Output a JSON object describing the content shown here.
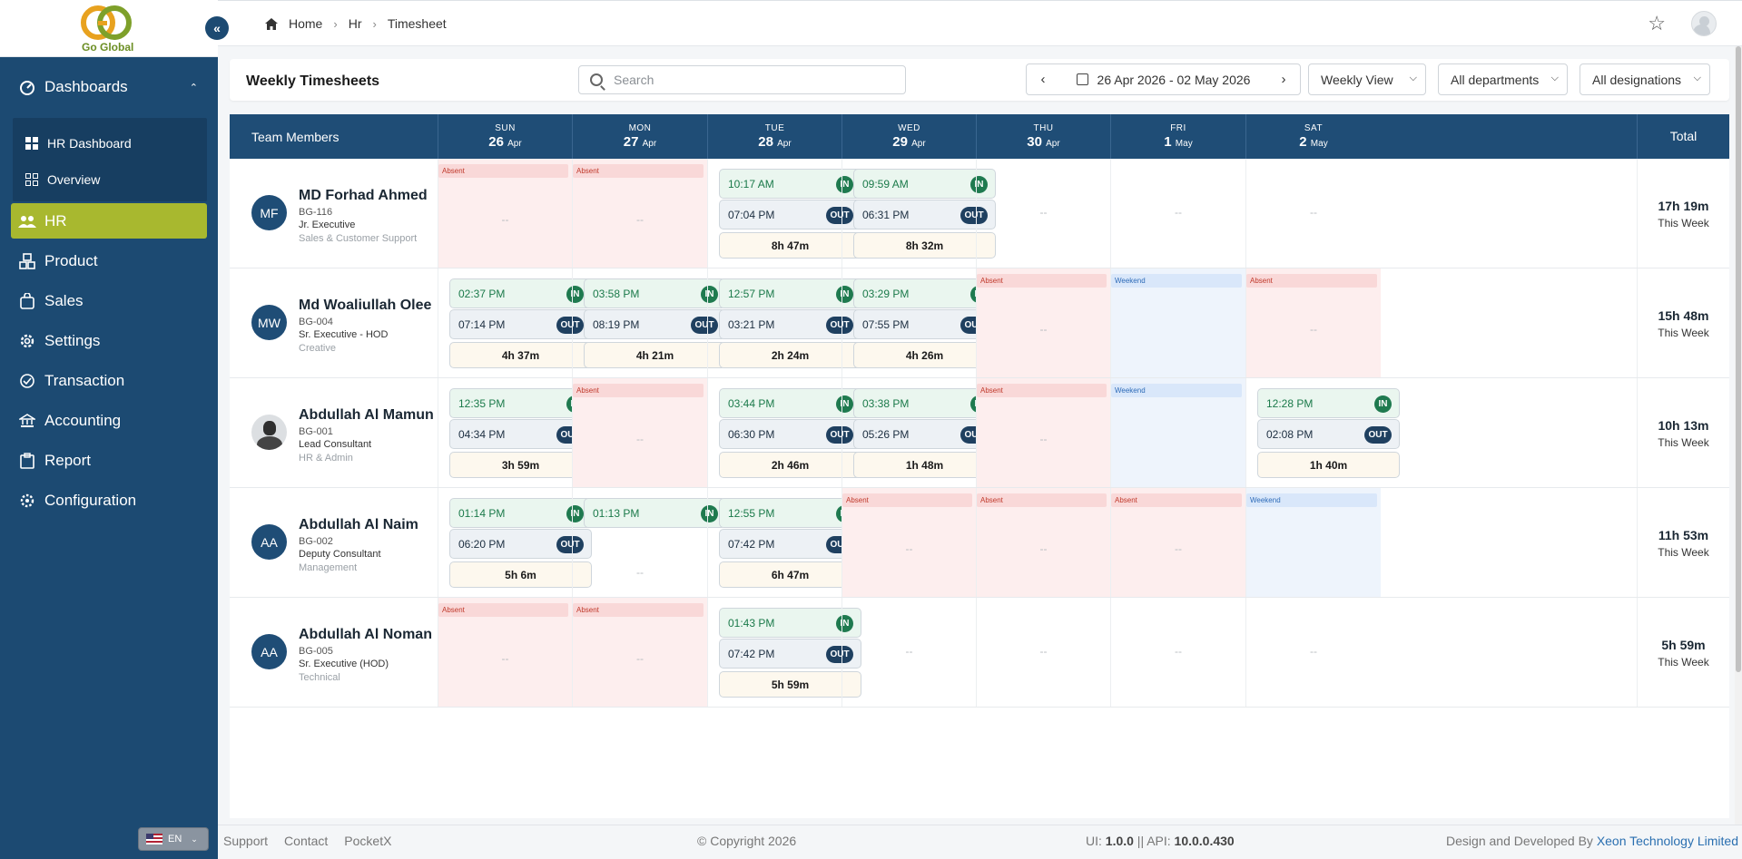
{
  "brand": {
    "name": "Go Global"
  },
  "sidebar": {
    "items": [
      {
        "label": "Dashboards",
        "icon": "dashboard-icon",
        "expanded": true
      },
      {
        "label": "HR",
        "icon": "users-icon",
        "active": true
      },
      {
        "label": "Product",
        "icon": "product-icon"
      },
      {
        "label": "Sales",
        "icon": "sales-icon"
      },
      {
        "label": "Settings",
        "icon": "gear-icon"
      },
      {
        "label": "Transaction",
        "icon": "transaction-icon"
      },
      {
        "label": "Accounting",
        "icon": "accounting-icon"
      },
      {
        "label": "Report",
        "icon": "report-icon"
      },
      {
        "label": "Configuration",
        "icon": "configuration-icon"
      }
    ],
    "submenu": [
      {
        "label": "HR Dashboard",
        "icon": "grid-icon"
      },
      {
        "label": "Overview",
        "icon": "overview-icon"
      }
    ],
    "language": "EN"
  },
  "breadcrumb": [
    "Home",
    "Hr",
    "Timesheet"
  ],
  "toolbar": {
    "title": "Weekly Timesheets",
    "search_placeholder": "Search",
    "date_range": "26 Apr 2026 - 02 May 2026",
    "view": "Weekly View",
    "department": "All departments",
    "designation": "All designations"
  },
  "table": {
    "member_header": "Team Members",
    "total_header": "Total",
    "days": [
      {
        "name": "SUN",
        "day": "26",
        "month": "Apr"
      },
      {
        "name": "MON",
        "day": "27",
        "month": "Apr"
      },
      {
        "name": "TUE",
        "day": "28",
        "month": "Apr"
      },
      {
        "name": "WED",
        "day": "29",
        "month": "Apr"
      },
      {
        "name": "THU",
        "day": "30",
        "month": "Apr"
      },
      {
        "name": "FRI",
        "day": "1",
        "month": "May"
      },
      {
        "name": "SAT",
        "day": "2",
        "month": "May"
      }
    ],
    "absent_label": "Absent",
    "weekend_label": "Weekend",
    "empty_label": "--",
    "in_label": "IN",
    "out_label": "OUT",
    "week_label": "This Week",
    "rows": [
      {
        "initials": "MF",
        "photo": false,
        "name": "MD Forhad Ahmed",
        "id": "BG-116",
        "role": "Jr. Executive",
        "dept": "Sales & Customer Support",
        "total": "17h 19m",
        "cells": [
          {
            "status": "absent"
          },
          {
            "status": "absent"
          },
          {
            "status": "present",
            "in": "10:17 AM",
            "out": "07:04 PM",
            "duration": "8h 47m"
          },
          {
            "status": "present",
            "in": "09:59 AM",
            "out": "06:31 PM",
            "duration": "8h 32m"
          },
          {
            "status": "empty"
          },
          {
            "status": "empty"
          },
          {
            "status": "empty"
          }
        ]
      },
      {
        "initials": "MW",
        "photo": false,
        "name": "Md Woaliullah Olee",
        "id": "BG-004",
        "role": "Sr. Executive - HOD",
        "dept": "Creative",
        "total": "15h 48m",
        "cells": [
          {
            "status": "present",
            "in": "02:37 PM",
            "out": "07:14 PM",
            "duration": "4h 37m"
          },
          {
            "status": "present",
            "in": "03:58 PM",
            "out": "08:19 PM",
            "duration": "4h 21m"
          },
          {
            "status": "present",
            "in": "12:57 PM",
            "out": "03:21 PM",
            "duration": "2h 24m"
          },
          {
            "status": "present",
            "in": "03:29 PM",
            "out": "07:55 PM",
            "duration": "4h 26m"
          },
          {
            "status": "absent"
          },
          {
            "status": "weekend"
          },
          {
            "status": "absent"
          }
        ]
      },
      {
        "initials": "",
        "photo": true,
        "name": "Abdullah Al Mamun",
        "id": "BG-001",
        "role": "Lead Consultant",
        "dept": "HR & Admin",
        "total": "10h 13m",
        "cells": [
          {
            "status": "present",
            "in": "12:35 PM",
            "out": "04:34 PM",
            "duration": "3h 59m"
          },
          {
            "status": "absent"
          },
          {
            "status": "present",
            "in": "03:44 PM",
            "out": "06:30 PM",
            "duration": "2h 46m"
          },
          {
            "status": "present",
            "in": "03:38 PM",
            "out": "05:26 PM",
            "duration": "1h 48m"
          },
          {
            "status": "absent"
          },
          {
            "status": "weekend"
          },
          {
            "status": "present",
            "in": "12:28 PM",
            "out": "02:08 PM",
            "duration": "1h 40m"
          }
        ]
      },
      {
        "initials": "AA",
        "photo": false,
        "name": "Abdullah Al Naim",
        "id": "BG-002",
        "role": "Deputy Consultant",
        "dept": "Management",
        "total": "11h 53m",
        "cells": [
          {
            "status": "present",
            "in": "01:14 PM",
            "out": "06:20 PM",
            "duration": "5h 6m"
          },
          {
            "status": "in_only",
            "in": "01:13 PM"
          },
          {
            "status": "present",
            "in": "12:55 PM",
            "out": "07:42 PM",
            "duration": "6h 47m"
          },
          {
            "status": "absent"
          },
          {
            "status": "absent"
          },
          {
            "status": "absent"
          },
          {
            "status": "weekend"
          }
        ]
      },
      {
        "initials": "AA",
        "photo": false,
        "name": "Abdullah Al Noman",
        "id": "BG-005",
        "role": "Sr. Executive (HOD)",
        "dept": "Technical",
        "total": "5h 59m",
        "cells": [
          {
            "status": "absent"
          },
          {
            "status": "absent"
          },
          {
            "status": "present",
            "in": "01:43 PM",
            "out": "07:42 PM",
            "duration": "5h 59m"
          },
          {
            "status": "empty"
          },
          {
            "status": "empty"
          },
          {
            "status": "empty"
          },
          {
            "status": "empty"
          }
        ]
      }
    ]
  },
  "footer": {
    "links": [
      "Support",
      "Contact",
      "PocketX"
    ],
    "copyright": "© Copyright 2026",
    "version_prefix": "UI: ",
    "ui_version": "1.0.0",
    "version_sep": " || API: ",
    "api_version": "10.0.0.430",
    "credit_prefix": "Design and Developed By ",
    "credit_link": "Xeon Technology Limited"
  },
  "colors": {
    "primary": "#1f4d76",
    "sidebar": "#1c4a72",
    "accent": "#a8b82f",
    "in": "#1f7a4f",
    "absent": "#fdeeee",
    "weekend": "#eef4fc"
  }
}
